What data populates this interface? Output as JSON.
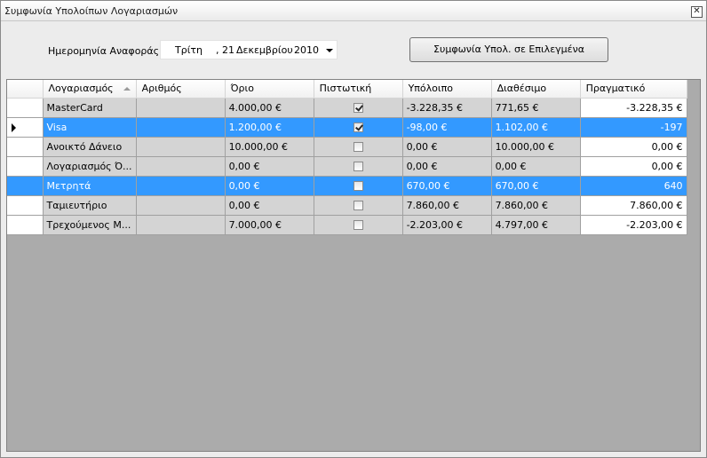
{
  "window": {
    "title": "Συμφωνία Υπολοίπων Λογαριασμών",
    "close_glyph": "✕"
  },
  "toolbar": {
    "date_label": "Ημερομηνία Αναφοράς",
    "date": {
      "weekday": "Τρίτη",
      "day": ", 21",
      "month": "Δεκεμβρίου",
      "year": "2010"
    },
    "reconcile_button": "Συμφωνία Υπολ. σε Επιλεγμένα"
  },
  "grid": {
    "columns": [
      "Λογαριασμός",
      "Αριθμός",
      "Όριο",
      "Πιστωτική",
      "Υπόλοιπο",
      "Διαθέσιμο",
      "Πραγματικό"
    ],
    "sorted_column": "Λογαριασμός",
    "rows": [
      {
        "account": "MasterCard",
        "number": "",
        "limit": "4.000,00 €",
        "credit": true,
        "balance": "-3.228,35 €",
        "available": "771,65 €",
        "actual": "-3.228,35 €",
        "state": "normal"
      },
      {
        "account": "Visa",
        "number": "",
        "limit": "1.200,00 €",
        "credit": true,
        "balance": "-98,00 €",
        "available": "1.102,00 €",
        "actual": "-197",
        "state": "current"
      },
      {
        "account": "Ανοικτό Δάνειο",
        "number": "",
        "limit": "10.000,00 €",
        "credit": false,
        "balance": "0,00 €",
        "available": "10.000,00 €",
        "actual": "0,00 €",
        "state": "normal"
      },
      {
        "account": "Λογαριασμός Ό...",
        "number": "",
        "limit": "0,00 €",
        "credit": false,
        "balance": "0,00 €",
        "available": "0,00 €",
        "actual": "0,00 €",
        "state": "normal"
      },
      {
        "account": "Μετρητά",
        "number": "",
        "limit": "0,00 €",
        "credit": false,
        "balance": "670,00 €",
        "available": "670,00 €",
        "actual": "640",
        "state": "selected"
      },
      {
        "account": "Ταμιευτήριο",
        "number": "",
        "limit": "0,00 €",
        "credit": false,
        "balance": "7.860,00 €",
        "available": "7.860,00 €",
        "actual": "7.860,00 €",
        "state": "normal"
      },
      {
        "account": "Τρεχούμενος Μ...",
        "number": "",
        "limit": "7.000,00 €",
        "credit": false,
        "balance": "-2.203,00 €",
        "available": "4.797,00 €",
        "actual": "-2.203,00 €",
        "state": "normal"
      }
    ]
  },
  "colors": {
    "selection": "#3399ff",
    "cell": "#d4d4d4",
    "empty_grid": "#ababab"
  }
}
